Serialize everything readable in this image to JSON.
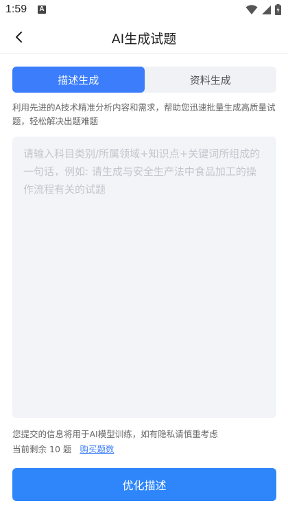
{
  "status": {
    "time": "1:59",
    "notif_glyph": "A",
    "icons": [
      "wifi-icon",
      "cellular-signal-icon",
      "battery-icon"
    ]
  },
  "header": {
    "title": "AI生成试题",
    "back_icon": "chevron-left-icon"
  },
  "tabs": [
    {
      "label": "描述生成",
      "active": true
    },
    {
      "label": "资料生成",
      "active": false
    }
  ],
  "intro": "利用先进的A技术精准分析内容和需求，帮助您迅速批量生成高质量试题，轻松解决出题难题",
  "input": {
    "value": "",
    "placeholder": "请输入科目类别/所属领域+知识点+关键词所组成的一句话，例如: 请生成与安全生产法中食品加工的操作流程有关的试题"
  },
  "notice": "您提交的信息将用于AI模型训练，如有隐私请慎重考虑",
  "remaining": {
    "prefix": "当前剩余",
    "count": "10",
    "unit": "题",
    "buy_label": "购买题数"
  },
  "submit_label": "优化描述",
  "colors": {
    "accent": "#3b7dfb",
    "button": "#2f86fb",
    "tab_bg": "#f0f2f6",
    "input_bg": "#f3f4f8"
  }
}
